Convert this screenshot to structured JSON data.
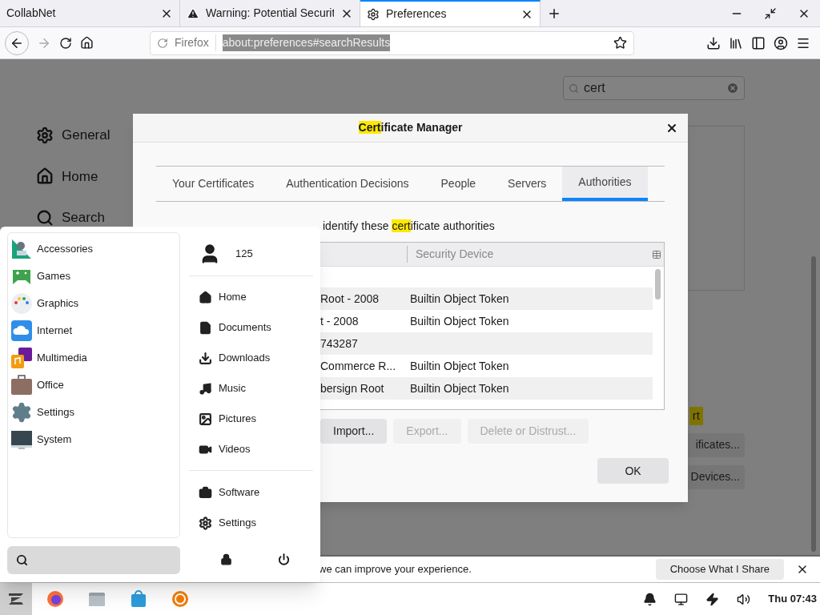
{
  "browser": {
    "tabs": [
      {
        "title": "CollabNet",
        "selected": false,
        "kind": "plain"
      },
      {
        "title": "Warning: Potential Securit",
        "selected": false,
        "kind": "warning"
      },
      {
        "title": "Preferences",
        "selected": true,
        "kind": "settings"
      }
    ],
    "forward_disabled": true,
    "url_bar": {
      "identity": "Firefox",
      "url": "about:preferences#searchResults",
      "url_selected": true
    }
  },
  "preferences": {
    "sidebar": [
      {
        "label": "General",
        "kind": "settings"
      },
      {
        "label": "Home",
        "kind": "home"
      },
      {
        "label": "Search",
        "kind": "search"
      }
    ],
    "search": {
      "value": "cert"
    },
    "highlight_fragment": "rt",
    "buttons": [
      "ificates...",
      "Devices..."
    ]
  },
  "dialog": {
    "title": [
      {
        "text": "Cert",
        "highlight": true
      },
      {
        "text": "ificate Manager",
        "highlight": false
      }
    ],
    "tabs": [
      {
        "label": "Your Certificates",
        "selected": false
      },
      {
        "label": "Authentication Decisions",
        "selected": false
      },
      {
        "label": "People",
        "selected": false
      },
      {
        "label": "Servers",
        "selected": false
      },
      {
        "label": "Authorities",
        "selected": true
      }
    ],
    "description": [
      {
        "text": "identify these ",
        "highlight": false
      },
      {
        "text": "cert",
        "highlight": true
      },
      {
        "text": "ificate authorities",
        "highlight": false
      }
    ],
    "header": "Security Device",
    "rows": [
      {
        "column_1": "Root - 2008",
        "column_2": "Builtin Object Token"
      },
      {
        "column_1": "t - 2008",
        "column_2": "Builtin Object Token"
      },
      {
        "column_1": "743287"
      },
      {
        "column_1": "Commerce R...",
        "column_2": "Builtin Object Token"
      },
      {
        "column_1": "bersign Root",
        "column_2": "Builtin Object Token"
      }
    ],
    "buttons": [
      {
        "label": "Import...",
        "disabled": false
      },
      {
        "label": "Export...",
        "disabled": true
      },
      {
        "label": "Delete or Distrust...",
        "disabled": true
      }
    ],
    "ok": "OK"
  },
  "app_menu": {
    "categories": [
      {
        "label": "Accessories",
        "kind": "accessories"
      },
      {
        "label": "Games",
        "kind": "games"
      },
      {
        "label": "Graphics",
        "kind": "graphics"
      },
      {
        "label": "Internet",
        "kind": "internet"
      },
      {
        "label": "Multimedia",
        "kind": "multimedia"
      },
      {
        "label": "Office",
        "kind": "office"
      },
      {
        "label": "Settings",
        "kind": "settings"
      },
      {
        "label": "System",
        "kind": "system"
      }
    ],
    "user": "125",
    "places": [
      {
        "label": "Home",
        "kind": "home"
      },
      {
        "label": "Documents",
        "kind": "document"
      },
      {
        "label": "Downloads",
        "kind": "download"
      },
      {
        "label": "Music",
        "kind": "music"
      },
      {
        "label": "Pictures",
        "kind": "picture"
      },
      {
        "label": "Videos",
        "kind": "video"
      }
    ],
    "system": [
      {
        "label": "Software",
        "kind": "bag"
      },
      {
        "label": "Settings",
        "kind": "settings"
      }
    ]
  },
  "notification": {
    "text": "we can improve your experience.",
    "button": "Choose What I Share"
  },
  "taskbar": {
    "clock": "Thu 07:43"
  }
}
